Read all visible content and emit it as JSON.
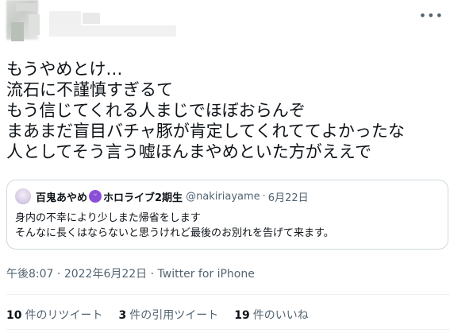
{
  "header": {
    "more_icon": "more-horizontal-icon"
  },
  "tweet": {
    "lines": [
      "もうやめとけ…",
      "流石に不謹慎すぎるて",
      "もう信じてくれる人まじでほぼおらんぞ",
      "まあまだ盲目バチャ豚が肯定してくれててよかったな",
      "人としてそう言う嘘ほんまやめといた方がええで"
    ]
  },
  "quote": {
    "name": "百鬼あやめ",
    "emoji": "demon-face-emoji",
    "name_suffix": "ホロライブ2期生",
    "handle": "@nakiriayame",
    "separator": "·",
    "date": "6月22日",
    "text_lines": [
      "身内の不幸により少しまた帰省をします",
      "そんなに長くはならないと思うけれど最後のお別れを告げて来ます。"
    ]
  },
  "meta": {
    "time": "午後8:07",
    "separator1": " · ",
    "date": "2022年6月22日",
    "separator2": " · ",
    "source": "Twitter for iPhone"
  },
  "stats": {
    "retweets": {
      "count": "10",
      "label": "件のリツイート"
    },
    "quotes": {
      "count": "3",
      "label": "件の引用ツイート"
    },
    "likes": {
      "count": "19",
      "label": "件のいいね"
    }
  },
  "colors": {
    "text": "#0f1419",
    "secondary": "#536471",
    "border": "#cfd9de",
    "divider": "#eff3f4"
  }
}
